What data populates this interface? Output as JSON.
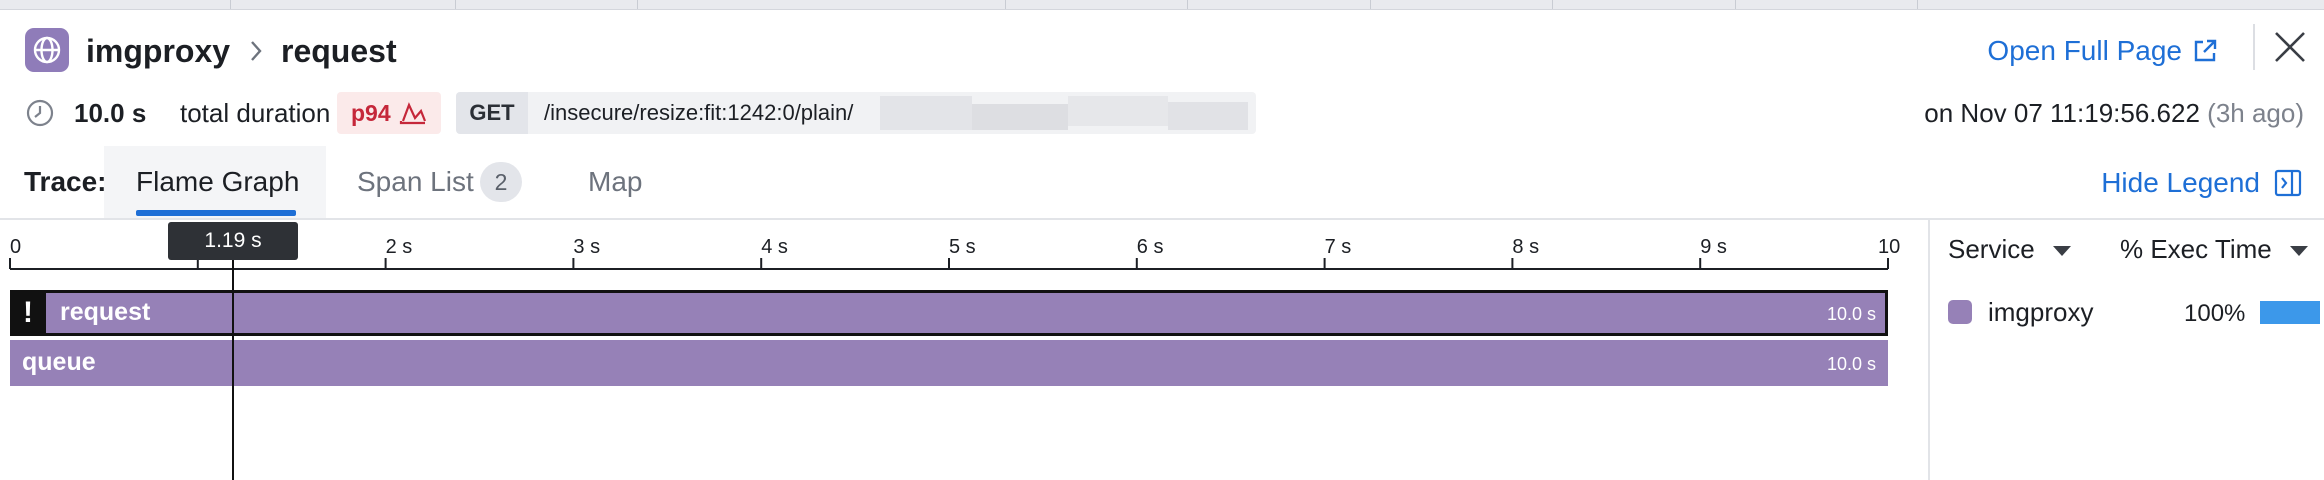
{
  "header": {
    "service_name": "imgproxy",
    "separator": ">",
    "span_name": "request",
    "open_full_page": "Open Full Page"
  },
  "info": {
    "duration_value": "10.0 s",
    "duration_label": "total duration",
    "percentile": "p94",
    "method": "GET",
    "path": "/insecure/resize:fit:1242:0/plain/",
    "date": "on Nov 07 11:19:56.622",
    "ago": "(3h ago)"
  },
  "tabs": {
    "trace_label": "Trace:",
    "items": [
      {
        "label": "Flame Graph",
        "active": true
      },
      {
        "label": "Span List",
        "count": "2"
      },
      {
        "label": "Map"
      }
    ],
    "hide_legend": "Hide Legend"
  },
  "flame": {
    "axis_ticks": [
      "0",
      "1 s",
      "2 s",
      "3 s",
      "4 s",
      "5 s",
      "6 s",
      "7 s",
      "8 s",
      "9 s",
      "10"
    ],
    "axis_max_s": 10,
    "cursor_s": 1.19,
    "cursor_label": "1.19 s",
    "spans": [
      {
        "name": "request",
        "duration": "10.0 s",
        "start_s": 0,
        "end_s": 10.0,
        "error": true,
        "error_symbol": "!"
      },
      {
        "name": "queue",
        "duration": "10.0 s",
        "start_s": 0,
        "end_s": 10.0,
        "error": false
      }
    ]
  },
  "legend": {
    "col_service": "Service",
    "col_exec": "% Exec Time",
    "rows": [
      {
        "service": "imgproxy",
        "percent": "100%",
        "fraction": 1.0,
        "color": "#9681b7"
      }
    ]
  },
  "colors": {
    "accent": "#1e6fd6",
    "span": "#9681b7",
    "error": "#c5273a",
    "exec_bar": "#3c98ea"
  }
}
